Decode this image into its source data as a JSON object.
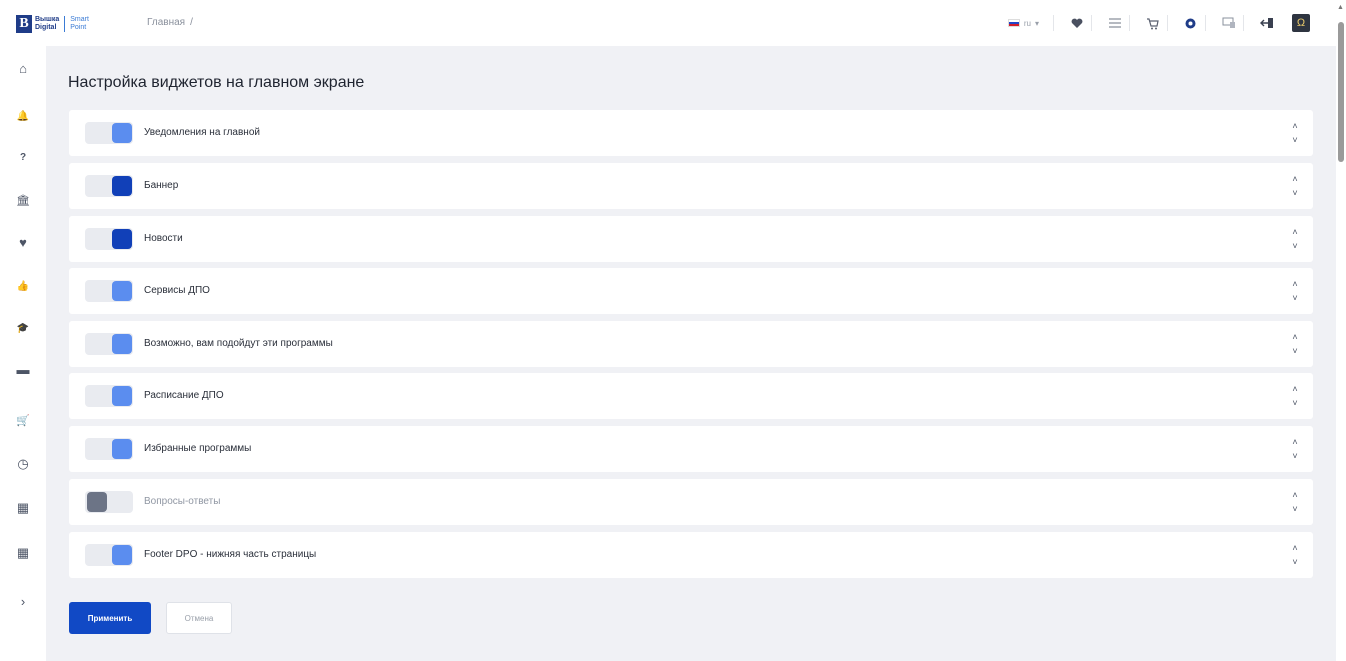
{
  "header": {
    "logo": {
      "line1": "Вышка",
      "line2": "Digital",
      "brand1": "Smart",
      "brand2": "Point"
    },
    "breadcrumb": {
      "current": "Главная",
      "separator": "/"
    },
    "lang": {
      "code": "ru",
      "caret": "▾"
    },
    "icons": [
      "heart-icon",
      "list-icon",
      "cart-icon",
      "settings-icon",
      "monitor-icon",
      "logout-icon"
    ]
  },
  "sidebar": {
    "items": [
      {
        "name": "home-icon",
        "glyph": "⌂"
      },
      {
        "name": "bell-icon",
        "glyph": "🔔"
      },
      {
        "name": "help-icon",
        "glyph": "?"
      },
      {
        "name": "university-icon",
        "glyph": "🏛"
      },
      {
        "name": "heart-icon",
        "glyph": "♥"
      },
      {
        "name": "like-icon",
        "glyph": "👍"
      },
      {
        "name": "graduation-icon",
        "glyph": "🎓"
      },
      {
        "name": "folder-icon",
        "glyph": "▬"
      },
      {
        "name": "cart-icon",
        "glyph": "🛒"
      },
      {
        "name": "clock-icon",
        "glyph": "◷"
      },
      {
        "name": "briefcase-icon",
        "glyph": "▦"
      },
      {
        "name": "briefcase2-icon",
        "glyph": "▦"
      },
      {
        "name": "expand-icon",
        "glyph": "›"
      }
    ]
  },
  "main": {
    "title": "Настройка виджетов на главном экране",
    "widgets": [
      {
        "label": "Уведомления на главной",
        "state": "on"
      },
      {
        "label": "Баннер",
        "state": "on-strong"
      },
      {
        "label": "Новости",
        "state": "on-strong"
      },
      {
        "label": "Сервисы ДПО",
        "state": "on"
      },
      {
        "label": "Возможно, вам подойдут эти программы",
        "state": "on"
      },
      {
        "label": "Расписание ДПО",
        "state": "on"
      },
      {
        "label": "Избранные программы",
        "state": "on"
      },
      {
        "label": "Вопросы-ответы",
        "state": "off"
      },
      {
        "label": "Footer DPO - нижняя часть страницы",
        "state": "on"
      }
    ],
    "apply_label": "Применить",
    "cancel_label": "Отмена",
    "chevron_up": "˄",
    "chevron_down": "˅"
  },
  "colors": {
    "accent": "#1149c5",
    "toggle_on": "#5b8def",
    "toggle_on_strong": "#1140b8",
    "toggle_off": "#6c7486",
    "background": "#f0f1f5"
  }
}
